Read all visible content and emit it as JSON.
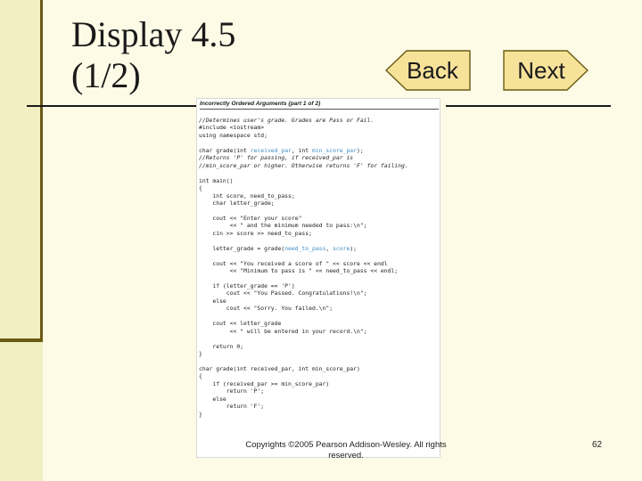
{
  "slide": {
    "title_line1": "Display 4.5",
    "title_line2": "(1/2)",
    "back_label": "Back",
    "next_label": "Next",
    "footer": "Copyrights ©2005 Pearson Addison-Wesley. All rights reserved.",
    "page_number": "62"
  },
  "code": {
    "heading": "Incorrectly Ordered Arguments (part 1 of 2)",
    "lines": [
      "//Determines user's grade. Grades are Pass or Fail.",
      "#include <iostream>",
      "using namespace std;",
      "",
      "char grade(int received_par, int min_score_par);",
      "//Returns 'P' for passing, if received_par is",
      "//min_score_par or higher. Otherwise returns 'F' for failing.",
      "",
      "int main()",
      "{",
      "    int score, need_to_pass;",
      "    char letter_grade;",
      "",
      "    cout << \"Enter your score\"",
      "         << \" and the minimum needed to pass:\\n\";",
      "    cin >> score >> need_to_pass;",
      "",
      "    letter_grade = grade(need_to_pass, score);",
      "",
      "    cout << \"You received a score of \" << score << endl",
      "         << \"Minimum to pass is \" << need_to_pass << endl;",
      "",
      "    if (letter_grade == 'P')",
      "        cout << \"You Passed. Congratulations!\\n\";",
      "    else",
      "        cout << \"Sorry. You failed.\\n\";",
      "",
      "    cout << letter_grade",
      "         << \" will be entered in your record.\\n\";",
      "",
      "    return 0;",
      "}",
      "",
      "char grade(int received_par, int min_score_par)",
      "{",
      "    if (received_par >= min_score_par)",
      "        return 'P';",
      "    else",
      "        return 'F';",
      "}"
    ]
  },
  "colors": {
    "background": "#fdfbe6",
    "left_band": "#f1efc3",
    "accent_line": "#6a5a14",
    "button_fill": "#f7e29a",
    "highlight": "#3f8fc4"
  }
}
